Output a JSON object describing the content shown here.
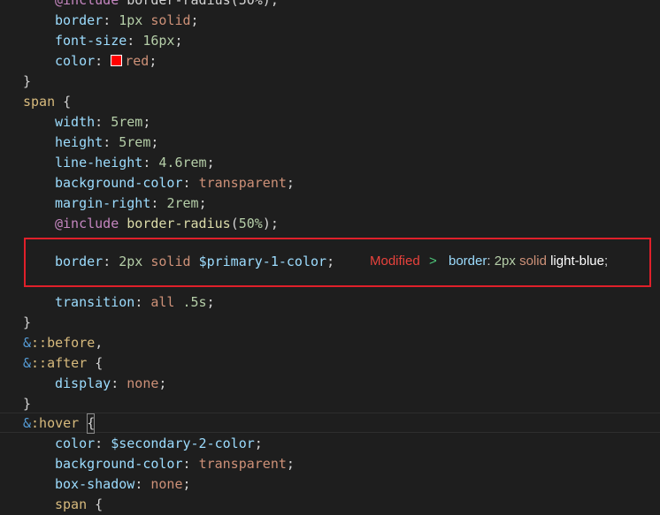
{
  "colors": {
    "background": "#1e1e1e",
    "property": "#9cdcfe",
    "number": "#b5cea8",
    "string": "#ce9178",
    "selector": "#d7ba7d",
    "ampersand": "#569cd6",
    "annotation_border": "#e0202a",
    "annotation_modified": "#e8423c",
    "swatch": "#ff0000"
  },
  "code": {
    "l0": {
      "kw": "@include",
      "rest": " border-radius(50%);"
    },
    "l1": {
      "prop": "border",
      "v1": "1px",
      "v2": " solid"
    },
    "l2": {
      "prop": "font-size",
      "v1": "16px"
    },
    "l3": {
      "prop": "color",
      "v1": "red"
    },
    "l4": {
      "text": "}"
    },
    "l5": {
      "sel": "span",
      "rest": " {"
    },
    "l6": {
      "prop": "width",
      "v1": "5rem"
    },
    "l7": {
      "prop": "height",
      "v1": "5rem"
    },
    "l8": {
      "prop": "line-height",
      "v1": "4.6rem"
    },
    "l9": {
      "prop": "background-color",
      "v1": "transparent"
    },
    "l10": {
      "prop": "margin-right",
      "v1": "2rem"
    },
    "l11": {
      "kw": "@include",
      "fn": " border-radius",
      "open": "(",
      "num": "50%",
      "close": ");"
    },
    "l12": {
      "prop": "border",
      "v1": "2px",
      "v2": "solid",
      "v3": "$primary-1-color"
    },
    "l13": {
      "prop": "transition",
      "v1": "all",
      "v2": ".5s"
    },
    "l14": {
      "text": "}"
    },
    "l15": {
      "amp": "&",
      "sel": "::before",
      "rest": ","
    },
    "l16": {
      "amp": "&",
      "sel": "::after",
      "rest": " {"
    },
    "l17": {
      "prop": "display",
      "v1": "none"
    },
    "l18": {
      "text": "}"
    },
    "l19": {
      "amp": "&",
      "sel": ":hover",
      "open": "{"
    },
    "l20": {
      "prop": "color",
      "v1": "$secondary-2-color"
    },
    "l21": {
      "prop": "background-color",
      "v1": "transparent"
    },
    "l22": {
      "prop": "box-shadow",
      "v1": "none"
    },
    "l23": {
      "sel": "span",
      "rest": " {"
    }
  },
  "annotation": {
    "modified_label": "Modified",
    "arrow": ">",
    "prop": "border",
    "num": "2px",
    "kw": "solid",
    "val": "light-blue",
    "end": ";"
  }
}
